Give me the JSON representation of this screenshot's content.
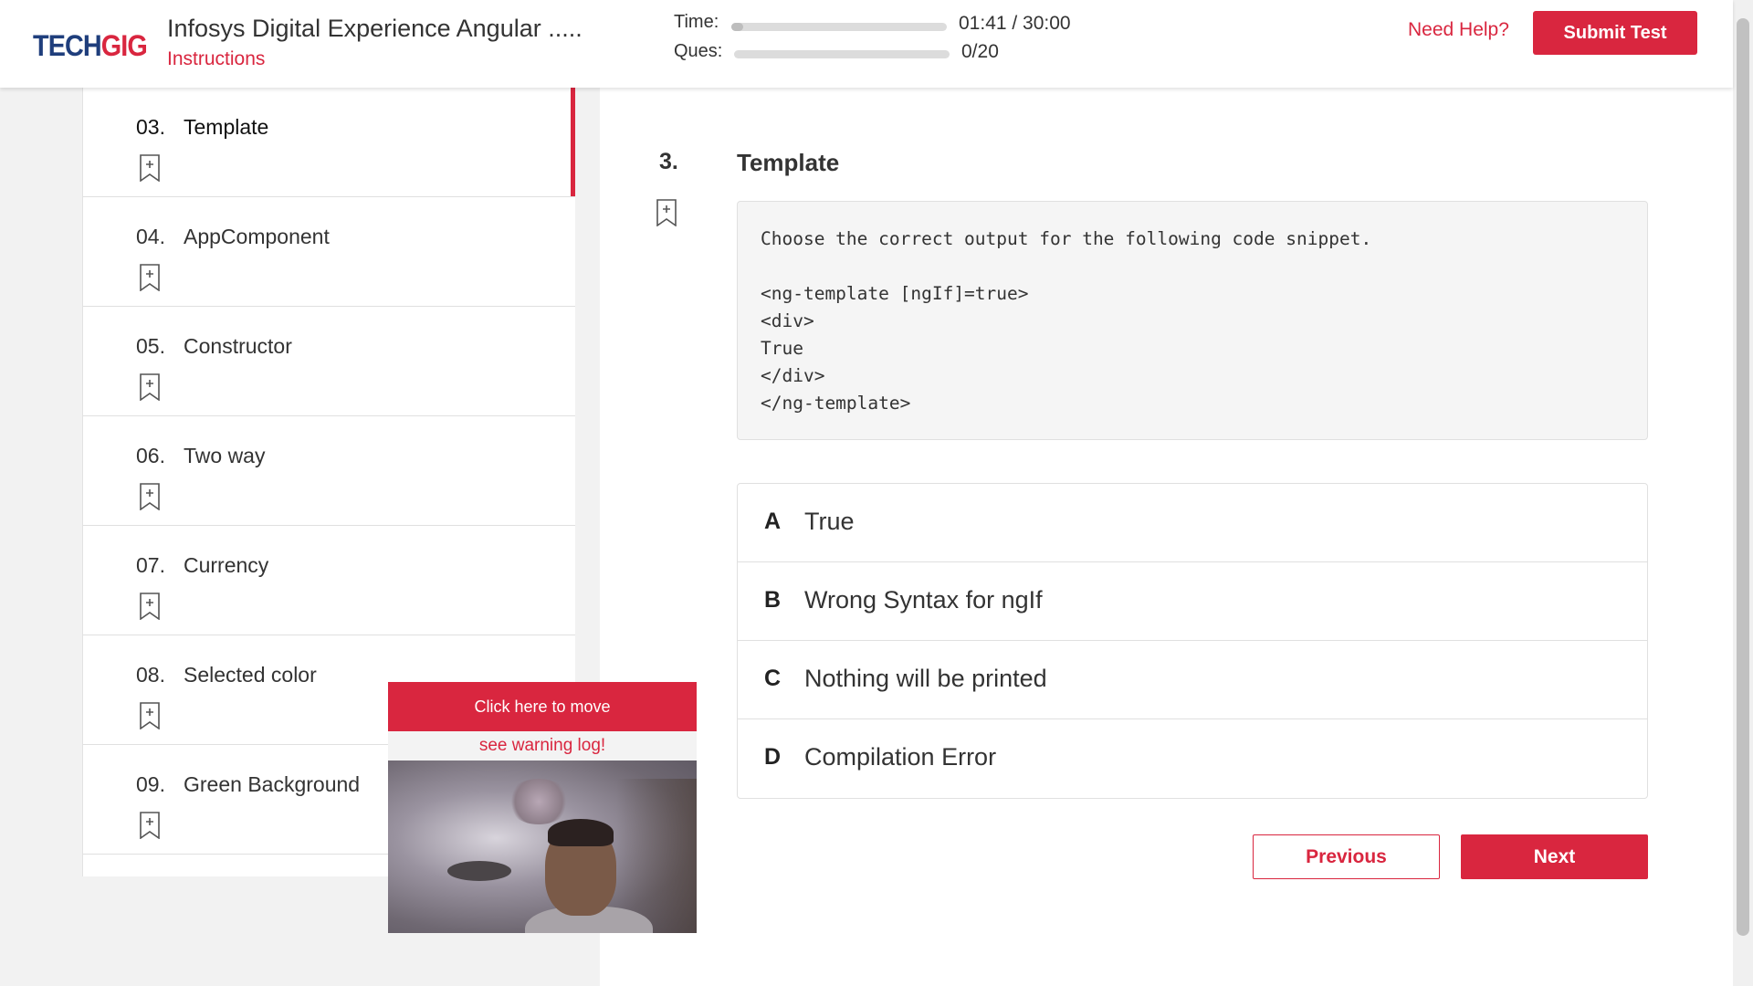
{
  "header": {
    "logo_tech": "TECH",
    "logo_gig": "GIG",
    "title": "Infosys Digital Experience Angular .....",
    "instructions_link": "Instructions",
    "time_label": "Time:",
    "time_value": "01:41 / 30:00",
    "time_progress": 0.056,
    "ques_label": "Ques:",
    "ques_value": "0/20",
    "ques_progress": 0,
    "need_help": "Need Help?",
    "submit_label": "Submit Test"
  },
  "sidebar": {
    "items": [
      {
        "num": "03.",
        "name": "Template",
        "active": true
      },
      {
        "num": "04.",
        "name": "AppComponent"
      },
      {
        "num": "05.",
        "name": "Constructor"
      },
      {
        "num": "06.",
        "name": "Two way"
      },
      {
        "num": "07.",
        "name": "Currency"
      },
      {
        "num": "08.",
        "name": "Selected color"
      },
      {
        "num": "09.",
        "name": "Green Background"
      }
    ]
  },
  "question": {
    "number": "3.",
    "title": "Template",
    "code": "Choose the correct output for the following code snippet.\n\n<ng-template [ngIf]=true>\n<div>\nTrue\n</div>\n</ng-template>",
    "options": [
      {
        "letter": "A",
        "text": "True"
      },
      {
        "letter": "B",
        "text": "Wrong Syntax for ngIf"
      },
      {
        "letter": "C",
        "text": "Nothing will be printed"
      },
      {
        "letter": "D",
        "text": "Compilation Error"
      }
    ]
  },
  "nav": {
    "previous": "Previous",
    "next": "Next"
  },
  "proctor": {
    "move_label": "Click here to move",
    "warning_link": "see warning log!"
  },
  "colors": {
    "accent": "#d9263f",
    "logo_blue": "#1f3e7c"
  }
}
